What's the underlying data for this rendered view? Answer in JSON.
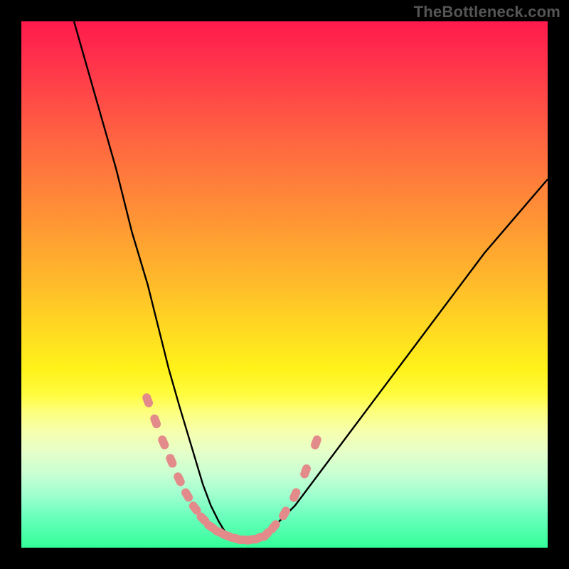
{
  "watermark": {
    "text": "TheBottleneck.com"
  },
  "colors": {
    "background": "#000000",
    "curve": "#000000",
    "marker_fill": "#e38a8a",
    "gradient_top": "#ff1a4d",
    "gradient_bottom": "#33ff99"
  },
  "chart_data": {
    "type": "line",
    "title": "",
    "xlabel": "",
    "ylabel": "",
    "xlim": [
      0,
      100
    ],
    "ylim": [
      0,
      100
    ],
    "grid": false,
    "series": [
      {
        "name": "bottleneck-curve",
        "x": [
          10,
          14,
          18,
          21,
          24,
          26,
          28,
          30,
          31.5,
          33,
          34.5,
          36,
          37.5,
          39,
          41,
          43,
          47,
          52,
          58,
          64,
          70,
          76,
          82,
          88,
          94,
          100
        ],
        "values": [
          100,
          86,
          72,
          60,
          50,
          42,
          34,
          27,
          22,
          17,
          12,
          8,
          5,
          2.5,
          1,
          1,
          3,
          8,
          16,
          24,
          32,
          40,
          48,
          56,
          63,
          70
        ]
      }
    ],
    "markers": {
      "name": "highlighted-points",
      "x": [
        24,
        25.5,
        27,
        28.5,
        30,
        31.5,
        33,
        34.5,
        36,
        37.5,
        39,
        40.5,
        42,
        43.5,
        45,
        46.5,
        48,
        50,
        52,
        54,
        56
      ],
      "y": [
        28,
        24,
        20,
        16.5,
        13,
        10,
        7.5,
        5.5,
        4,
        3,
        2.3,
        1.8,
        1.5,
        1.5,
        1.8,
        2.5,
        4,
        6.5,
        10,
        14.5,
        20
      ]
    },
    "gradient_bands": [
      {
        "y_position": 0.0,
        "color": "#ff1a4d"
      },
      {
        "y_position": 0.48,
        "color": "#ffb52c"
      },
      {
        "y_position": 0.66,
        "color": "#fff21a"
      },
      {
        "y_position": 1.0,
        "color": "#33ff99"
      }
    ]
  }
}
